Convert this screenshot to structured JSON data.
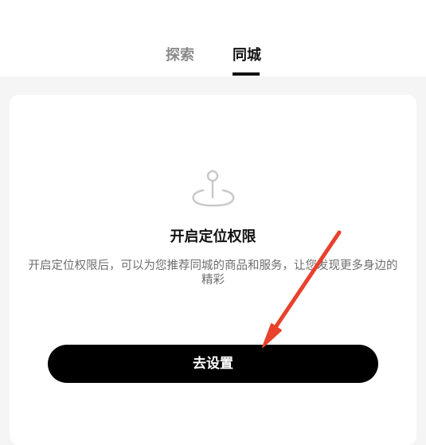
{
  "tabs": {
    "explore_label": "探索",
    "local_label": "同城",
    "active": "同城"
  },
  "permission_card": {
    "icon": "location-pin-icon",
    "title": "开启定位权限",
    "description": "开启定位权限后，可以为您推荐同城的商品和服务，让您发现更多身边的精彩",
    "button_label": "去设置"
  },
  "annotation": {
    "icon": "red-arrow-icon",
    "color": "#e8412c"
  },
  "colors": {
    "active_tab": "#111111",
    "inactive_tab": "#8a8a8a",
    "button_bg": "#000000",
    "page_bg": "#f5f5f5"
  }
}
